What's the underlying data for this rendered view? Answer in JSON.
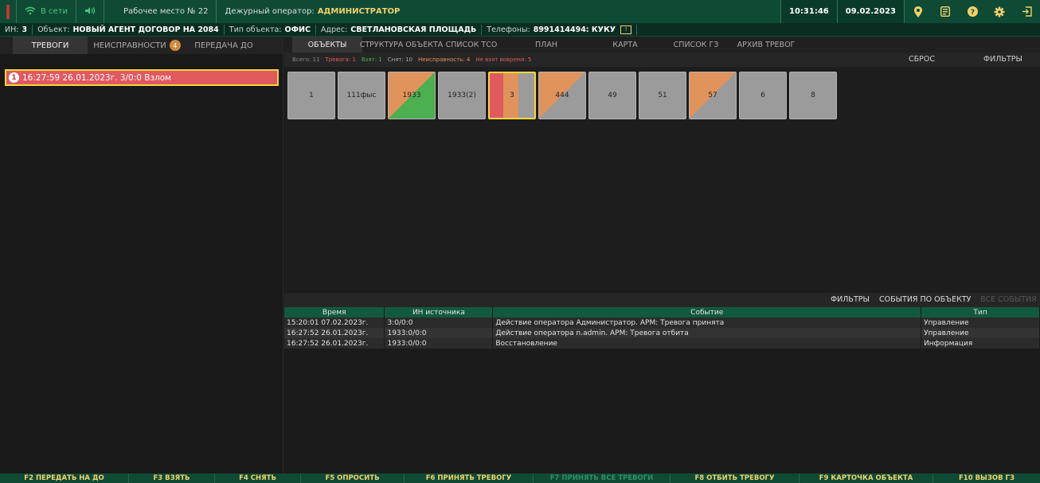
{
  "topbar": {
    "status": "В сети",
    "workplace": "Рабочее место № 22",
    "operator_label": "Дежурный оператор:",
    "operator_value": "АДМИНИСТРАТОР",
    "time": "10:31:46",
    "date": "09.02.2023",
    "icons": [
      "location-icon",
      "journal-icon",
      "help-icon",
      "settings-icon",
      "logout-icon"
    ]
  },
  "infobar": {
    "in_label": "ИН:",
    "in_value": "3",
    "object_label": "Объект:",
    "object_value": "НОВЫЙ АГЕНТ ДОГОВОР НА 2084",
    "type_label": "Тип объекта:",
    "type_value": "ОФИС",
    "address_label": "Адрес:",
    "address_value": "СВЕТЛАНОВСКАЯ ПЛОЩАДЬ",
    "phones_label": "Телефоны:",
    "phones_value": "8991414494: КУКУ"
  },
  "left_tabs": [
    {
      "label": "ТРЕВОГИ",
      "active": true
    },
    {
      "label": "НЕИСПРАВНОСТИ",
      "badge": "4"
    },
    {
      "label": "ПЕРЕДАЧА ДО"
    }
  ],
  "alarm": {
    "num": "1",
    "text": "16:27:59 26.01.2023г. 3/0:0 Взлом"
  },
  "right_tabs": [
    {
      "label": "ОБЪЕКТЫ",
      "active": true
    },
    {
      "label": "СТРУКТУРА ОБЪЕКТА"
    },
    {
      "label": "СПИСОК ТСО"
    },
    {
      "label": "ПЛАН"
    },
    {
      "label": "КАРТА"
    },
    {
      "label": "СПИСОК ГЗ"
    },
    {
      "label": "АРХИВ ТРЕВОГ"
    }
  ],
  "stats": {
    "total": "Всего: 11",
    "alarm": "Тревога: 1",
    "taken": "Взят: 1",
    "removed": "Снят: 10",
    "fault": "Неисправность: 4",
    "late": "Не взят вовремя: 5",
    "reset_label": "СБРОС",
    "filters_label": "ФИЛЬТРЫ"
  },
  "tiles": [
    {
      "label": "1",
      "style": "gray"
    },
    {
      "label": "111фыс",
      "style": "gray"
    },
    {
      "label": "1933",
      "style": "orange-green"
    },
    {
      "label": "1933(2)",
      "style": "gray"
    },
    {
      "label": "3",
      "style": "red-orange-gray",
      "selected": true
    },
    {
      "label": "444",
      "style": "orange-gray"
    },
    {
      "label": "49",
      "style": "gray"
    },
    {
      "label": "51",
      "style": "gray"
    },
    {
      "label": "57",
      "style": "orange-gray"
    },
    {
      "label": "6",
      "style": "gray"
    },
    {
      "label": "8",
      "style": "gray"
    }
  ],
  "events": {
    "filters_label": "ФИЛЬТРЫ",
    "by_object_label": "СОБЫТИЯ ПО ОБЪЕКТУ",
    "all_label": "ВСЕ СОБЫТИЯ",
    "columns": [
      "Время",
      "ИН источника",
      "Событие",
      "Тип"
    ],
    "rows": [
      [
        "15:20:01 07.02.2023г.",
        "3:0/0:0",
        "Действие оператора Администратор. АРМ: Тревога принята",
        "Управление"
      ],
      [
        "16:27:52 26.01.2023г.",
        "1933:0/0:0",
        "Действие оператора n.admin. АРМ: Тревога отбита",
        "Управление"
      ],
      [
        "16:27:52 26.01.2023г.",
        "1933:0/0:0",
        "Восстановление",
        "Информация"
      ]
    ]
  },
  "footer": [
    {
      "label": "F2 ПЕРЕДАТЬ НА ДО"
    },
    {
      "label": "F3 ВЗЯТЬ"
    },
    {
      "label": "F4 СНЯТЬ"
    },
    {
      "label": "F5 ОПРОСИТЬ"
    },
    {
      "label": "F6 ПРИНЯТЬ ТРЕВОГУ"
    },
    {
      "label": "F7 ПРИНЯТЬ ВСЕ ТРЕВОГИ",
      "disabled": true
    },
    {
      "label": "F8 ОТБИТЬ ТРЕВОГУ"
    },
    {
      "label": "F9 КАРТОЧКА ОБЪЕКТА"
    },
    {
      "label": "F10 ВЫЗОВ ГЗ"
    }
  ],
  "colors": {
    "green": "#0f4a35",
    "accent": "#f2d16b",
    "alarm": "#e0595f",
    "orange": "#e0935a",
    "ok": "#4caf50"
  }
}
